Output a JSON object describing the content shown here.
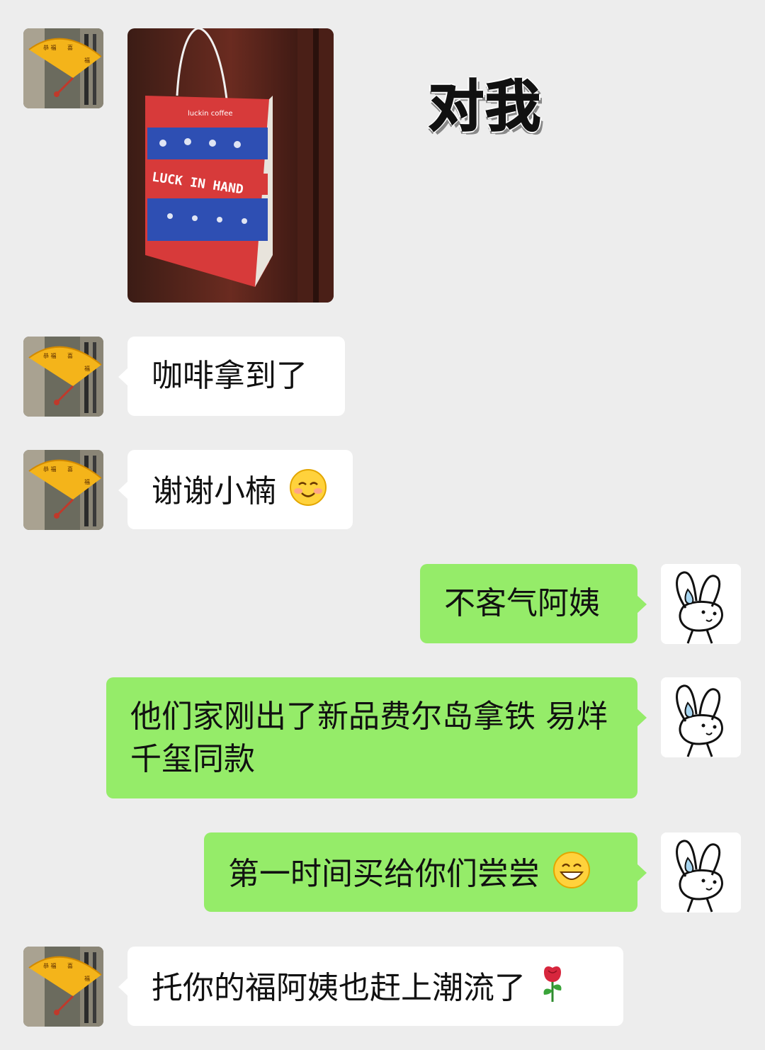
{
  "photo_message": {
    "bag_brand": "luckin coffee",
    "bag_slogan": "LUCK IN HAND",
    "sticker_text": "对我"
  },
  "messages": [
    {
      "side": "left",
      "text": "咖啡拿到了",
      "emoji": null
    },
    {
      "side": "left",
      "text": "谢谢小楠",
      "emoji": "blush-smile-emoji"
    },
    {
      "side": "right",
      "text": "不客气阿姨",
      "emoji": null
    },
    {
      "side": "right",
      "text": "他们家刚出了新品费尔岛拿铁 易烊千玺同款",
      "emoji": null
    },
    {
      "side": "right",
      "text": "第一时间买给你们尝尝",
      "emoji": "grin-emoji"
    },
    {
      "side": "left",
      "text": "托你的福阿姨也赶上潮流了",
      "emoji": "rose-emoji"
    }
  ],
  "colors": {
    "background": "#ededed",
    "incoming_bubble": "#ffffff",
    "outgoing_bubble": "#95ec69",
    "text": "#111111"
  }
}
